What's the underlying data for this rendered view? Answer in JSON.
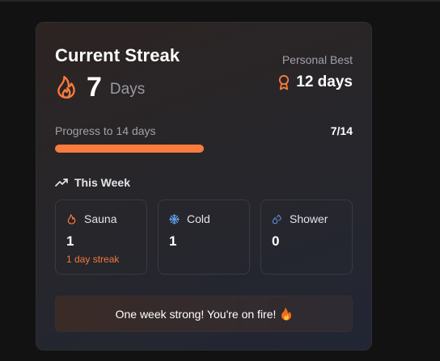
{
  "card": {
    "title": "Current Streak",
    "streak_count": "7",
    "streak_unit": "Days",
    "personal_best_label": "Personal Best",
    "personal_best_value": "12 days"
  },
  "progress": {
    "label": "Progress to 14 days",
    "count_text": "7/14",
    "fraction": 0.5,
    "fill_color": "#f97b3d"
  },
  "week": {
    "label": "This Week",
    "stats": [
      {
        "icon": "flame-icon",
        "label": "Sauna",
        "value": "1",
        "note": "1 day streak"
      },
      {
        "icon": "snowflake-icon",
        "label": "Cold",
        "value": "1",
        "note": ""
      },
      {
        "icon": "droplets-icon",
        "label": "Shower",
        "value": "0",
        "note": ""
      }
    ]
  },
  "banner": {
    "message": "One week strong! You're on fire!"
  },
  "colors": {
    "accent": "#f97b3d",
    "snow": "#5ea0e8",
    "droplets": "#5f85c4"
  }
}
